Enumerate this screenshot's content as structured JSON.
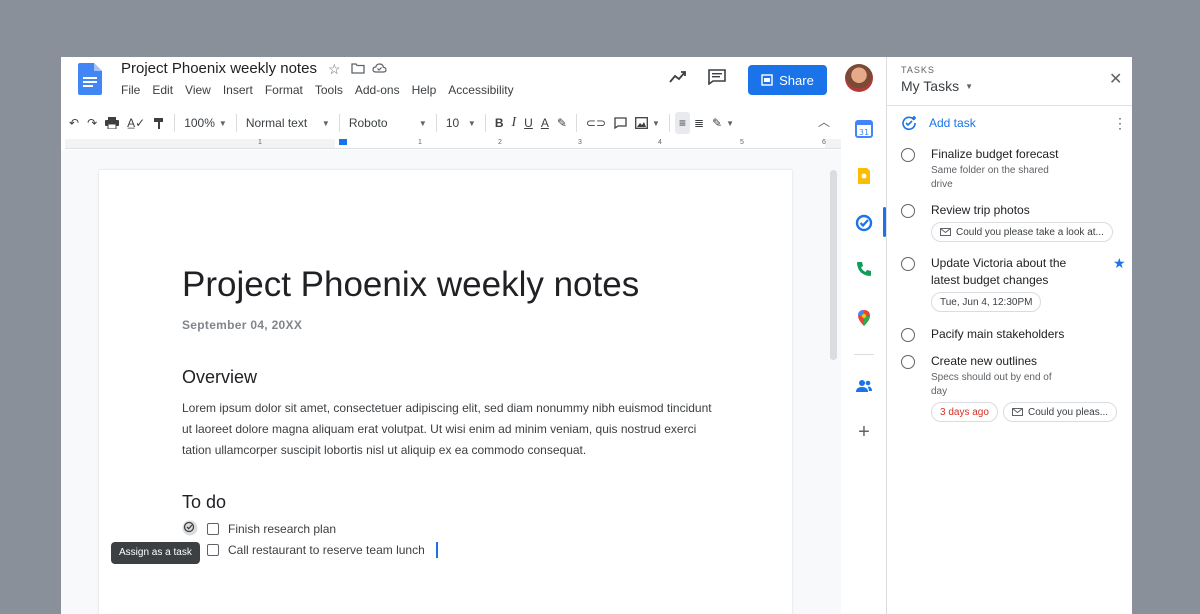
{
  "doc": {
    "title": "Project Phoenix weekly notes",
    "menu": [
      "File",
      "Edit",
      "View",
      "Insert",
      "Format",
      "Tools",
      "Add-ons",
      "Help",
      "Accessibility"
    ],
    "share_label": "Share"
  },
  "toolbar": {
    "zoom": "100%",
    "style": "Normal text",
    "font": "Roboto",
    "size": "10"
  },
  "ruler": {
    "numbers": [
      "1",
      "1",
      "2",
      "3",
      "4",
      "5",
      "6"
    ]
  },
  "page": {
    "heading": "Project Phoenix weekly notes",
    "date": "September 04, 20XX",
    "overview_heading": "Overview",
    "overview_text": "Lorem ipsum dolor sit amet, consectetuer adipiscing elit, sed diam nonummy nibh euismod tincidunt ut laoreet dolore magna aliquam erat volutpat. Ut wisi enim ad minim veniam, quis nostrud exerci tation ullamcorper suscipit lobortis nisl ut aliquip ex ea commodo consequat.",
    "todo_heading": "To do",
    "todos": [
      "Finish research plan",
      "Call restaurant to reserve team lunch"
    ],
    "tooltip": "Assign as a task"
  },
  "tasks": {
    "eyebrow": "TASKS",
    "list_name": "My Tasks",
    "add_label": "Add task",
    "items": [
      {
        "title": "Finalize budget forecast",
        "sub": "Same folder on the shared drive"
      },
      {
        "title": "Review trip photos",
        "chip": "Could you please take a look at..."
      },
      {
        "title": "Update Victoria about the latest budget changes",
        "chip": "Tue, Jun 4, 12:30PM"
      },
      {
        "title": "Pacify main stakeholders"
      },
      {
        "title": "Create new outlines",
        "sub": "Specs should out by end of day",
        "chip_due": "3 days ago",
        "chip": "Could you pleas..."
      }
    ]
  },
  "colors": {
    "accent": "#1a73e8",
    "overdue": "#d93025"
  }
}
